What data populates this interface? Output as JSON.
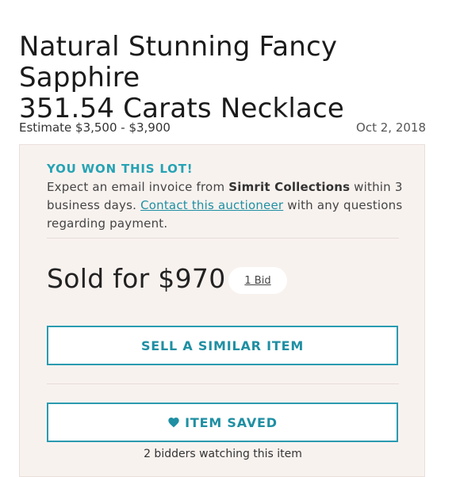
{
  "lot": {
    "title_line1": "Natural Stunning Fancy Sapphire",
    "title_line2": "351.54 Carats Necklace",
    "estimate": "Estimate $3,500 - $3,900",
    "date": "Oct 2, 2018"
  },
  "won": {
    "heading": "YOU WON THIS LOT!",
    "text_prefix": "Expect an email invoice from ",
    "seller": "Simrit Collections",
    "text_mid": " within 3 business days. ",
    "contact_link": "Contact this auctioneer",
    "text_suffix": " with any questions regarding payment."
  },
  "result": {
    "sold_label": "Sold for $970",
    "bids_label": "1 Bid"
  },
  "actions": {
    "sell_similar": "SELL A SIMILAR ITEM",
    "saved": "ITEM SAVED",
    "saved_icon": "heart-icon"
  },
  "watchers": "2 bidders watching this item",
  "colors": {
    "accent": "#2a9bb0",
    "panel_bg": "#f8f2ef"
  }
}
